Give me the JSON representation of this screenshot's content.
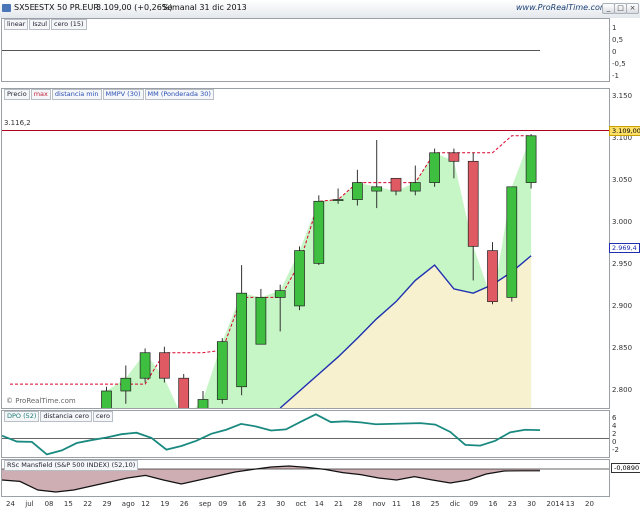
{
  "header": {
    "symbol": "SX5E",
    "name": "ESTX 50 PR.EUR",
    "price_change": "3.109,00 (+0,26%)",
    "period": "Semanal 31 dic 2013",
    "brand": "www.ProRealTime.com",
    "buttons": [
      "_",
      "□",
      "×"
    ]
  },
  "panel_top": {
    "legend": [
      "linear",
      "Iszul",
      "cero (15)"
    ],
    "ticks": [
      "1",
      "0,5",
      "0",
      "-0,5",
      "-1"
    ]
  },
  "price_panel": {
    "legend": [
      "Precio",
      "max",
      "distancia min",
      "MMPV (30)",
      "MM (Ponderada 30)"
    ],
    "hline_label": "3.116,2",
    "last_price": "3.109,00",
    "ma_value": "2.969,4",
    "ticks": [
      "3.150",
      "3.100",
      "3.050",
      "3.000",
      "2.950",
      "2.900",
      "2.850",
      "2.800"
    ],
    "watermark": "© ProRealTime.com",
    "colors": {
      "up": "#3fbf3f",
      "down": "#e05a64",
      "trail": "#d9002a",
      "wma": "#1f2fb0",
      "hline": "#b00020"
    }
  },
  "chart_data": {
    "type": "candlestick",
    "x": [
      "24 jun",
      "1 jul",
      "8 jul",
      "15 jul",
      "22 jul",
      "29 jul",
      "5 ago",
      "12 ago",
      "19 ago",
      "26 ago",
      "2 sep",
      "9 sep",
      "16 sep",
      "23 sep",
      "30 sep",
      "7 oct",
      "14 oct",
      "21 oct",
      "28 oct",
      "4 nov",
      "11 nov",
      "18 nov",
      "25 nov",
      "2 dic",
      "9 dic",
      "16 dic",
      "23 dic",
      "30 dic"
    ],
    "open": [
      null,
      null,
      null,
      null,
      null,
      2770,
      2810,
      2825,
      2855,
      2825,
      2780,
      2800,
      2815,
      2865,
      2920,
      2910,
      2960,
      3035,
      3035,
      3045,
      3060,
      3045,
      3055,
      3090,
      3080,
      2975,
      2920,
      3055
    ],
    "close": [
      null,
      null,
      null,
      null,
      null,
      2810,
      2825,
      2855,
      2825,
      2775,
      2800,
      2868,
      2925,
      2920,
      2928,
      2975,
      3033,
      3035,
      3055,
      3050,
      3045,
      3055,
      3090,
      3080,
      2980,
      2915,
      3050,
      3110
    ],
    "high": [
      null,
      null,
      null,
      null,
      null,
      2815,
      2840,
      2860,
      2862,
      2830,
      2810,
      2872,
      2958,
      2930,
      2935,
      2980,
      3040,
      3048,
      3070,
      3105,
      3060,
      3075,
      3095,
      3095,
      3090,
      2985,
      3050,
      3112
    ],
    "low": [
      null,
      null,
      null,
      null,
      null,
      2765,
      2795,
      2820,
      2820,
      2770,
      2775,
      2795,
      2805,
      2910,
      2880,
      2905,
      2958,
      3030,
      3028,
      3025,
      3040,
      3040,
      3050,
      3060,
      2940,
      2912,
      2915,
      3048
    ],
    "trailing_stop": [
      2818,
      2818,
      2818,
      2818,
      2818,
      2818,
      2818,
      2818,
      2855,
      2855,
      2855,
      2858,
      2920,
      2920,
      2920,
      2960,
      3033,
      3035,
      3055,
      3055,
      3055,
      3055,
      3090,
      3090,
      3090,
      3090,
      3110,
      3110
    ],
    "wma_30": [
      null,
      null,
      null,
      null,
      null,
      null,
      null,
      null,
      null,
      null,
      null,
      null,
      null,
      null,
      2790,
      2810,
      2830,
      2850,
      2872,
      2895,
      2915,
      2940,
      2958,
      2930,
      2925,
      2935,
      2950,
      2969
    ],
    "hline": 3116.2,
    "ylim": [
      2790,
      3165
    ]
  },
  "ind1": {
    "legend": [
      "DPO (52)",
      "distancia cero",
      "cero"
    ],
    "ticks": [
      "6",
      "4",
      "2",
      "0",
      "-2"
    ],
    "values": [
      0.8,
      -0.8,
      -0.9,
      -4.3,
      -3.2,
      -1.2,
      -0.4,
      0.3,
      1.2,
      1.6,
      0.2,
      -3.0,
      -2.0,
      -0.6,
      1.3,
      2.4,
      4.0,
      3.3,
      2.2,
      2.5,
      4.6,
      6.6,
      4.5,
      4.7,
      4.4,
      3.9,
      4.0,
      4.1,
      4.2,
      3.8,
      1.8,
      -1.7,
      -1.9,
      -0.6,
      1.7,
      2.4,
      2.3
    ],
    "ylim": [
      -5,
      7.5
    ]
  },
  "ind2": {
    "legend": "RSc Mansfield (S&P 500 INDEX) (52,10)",
    "value_label": "-0,0890",
    "ticks": [
      "0"
    ],
    "values": [
      -0.55,
      -0.62,
      -1.05,
      -1.15,
      -1.05,
      -0.85,
      -0.65,
      -0.45,
      -0.32,
      -0.55,
      -0.75,
      -0.55,
      -0.35,
      -0.15,
      -0.02,
      0.1,
      0.15,
      0.08,
      -0.02,
      -0.18,
      -0.28,
      -0.45,
      -0.55,
      -0.38,
      -0.55,
      -0.7,
      -0.55,
      -0.25,
      -0.1,
      -0.09,
      -0.09
    ],
    "ylim": [
      -1.35,
      0.45
    ]
  },
  "xaxis": {
    "labels": [
      "24",
      "jul",
      "08",
      "15",
      "22",
      "29",
      "ago",
      "12",
      "19",
      "26",
      "sep",
      "09",
      "16",
      "23",
      "30",
      "oct",
      "14",
      "21",
      "28",
      "nov",
      "11",
      "18",
      "25",
      "dic",
      "09",
      "16",
      "23",
      "30",
      "2014",
      "13",
      "20"
    ]
  }
}
